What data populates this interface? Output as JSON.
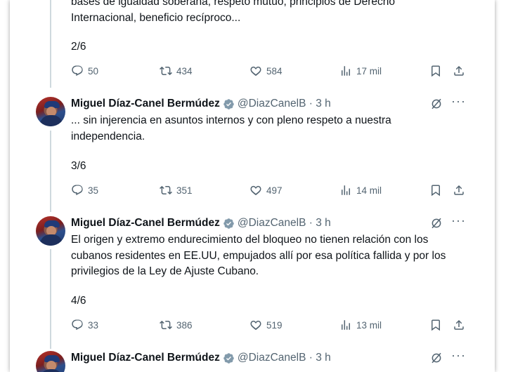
{
  "colors": {
    "text": "#0f1419",
    "muted": "#536471",
    "verified_badge": "#829aab",
    "thread_line": "#cfd9de"
  },
  "top_tweet": {
    "text_line1": "bases de igualdad soberana,  respeto mutuo, principios de Derecho",
    "text_line2": "Internacional, beneficio recíproco...",
    "count": "2/6",
    "replies": "50",
    "retweets": "434",
    "likes": "584",
    "views": "17 mil"
  },
  "tweets": [
    {
      "author": "Miguel Díaz-Canel Bermúdez",
      "handle": "@DiazCanelB · 3 h",
      "text": "... sin injerencia en asuntos internos y con pleno respeto a nuestra independencia.",
      "count": "3/6",
      "replies": "35",
      "retweets": "351",
      "likes": "497",
      "views": "14 mil"
    },
    {
      "author": "Miguel Díaz-Canel Bermúdez",
      "handle": "@DiazCanelB · 3 h",
      "text": "El origen y extremo endurecimiento del bloqueo no tienen relación con los cubanos residentes en EE.UU, empujados allí por esa política fallida y por los privilegios de la Ley de Ajuste Cubano.",
      "count": "4/6",
      "replies": "33",
      "retweets": "386",
      "likes": "519",
      "views": "13 mil"
    },
    {
      "author": "Miguel Díaz-Canel Bermúdez",
      "handle": "@DiazCanelB · 3 h"
    }
  ],
  "icons": {
    "reply": "reply-icon",
    "retweet": "retweet-icon",
    "like": "heart-icon",
    "views": "views-icon",
    "bookmark": "bookmark-icon",
    "share": "share-icon",
    "grok": "grok-icon",
    "more": "more-icon",
    "verified": "verified-badge-icon"
  }
}
